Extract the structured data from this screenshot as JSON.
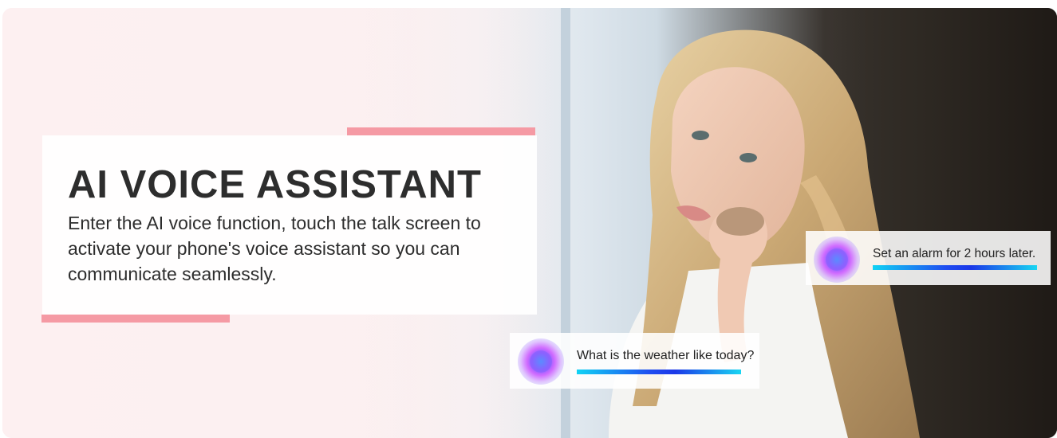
{
  "banner": {
    "title": "AI VOICE ASSISTANT",
    "description": "Enter the AI voice function, touch the talk screen to activate your phone's voice assistant so you can communicate seamlessly."
  },
  "bubbles": [
    {
      "text": "Set an alarm for 2 hours later."
    },
    {
      "text": "What is the weather like today?"
    }
  ],
  "colors": {
    "accent": "#f59aa4",
    "text": "#2d2d2d",
    "bar_start": "#11d3f4",
    "bar_mid": "#1f4cf0"
  }
}
